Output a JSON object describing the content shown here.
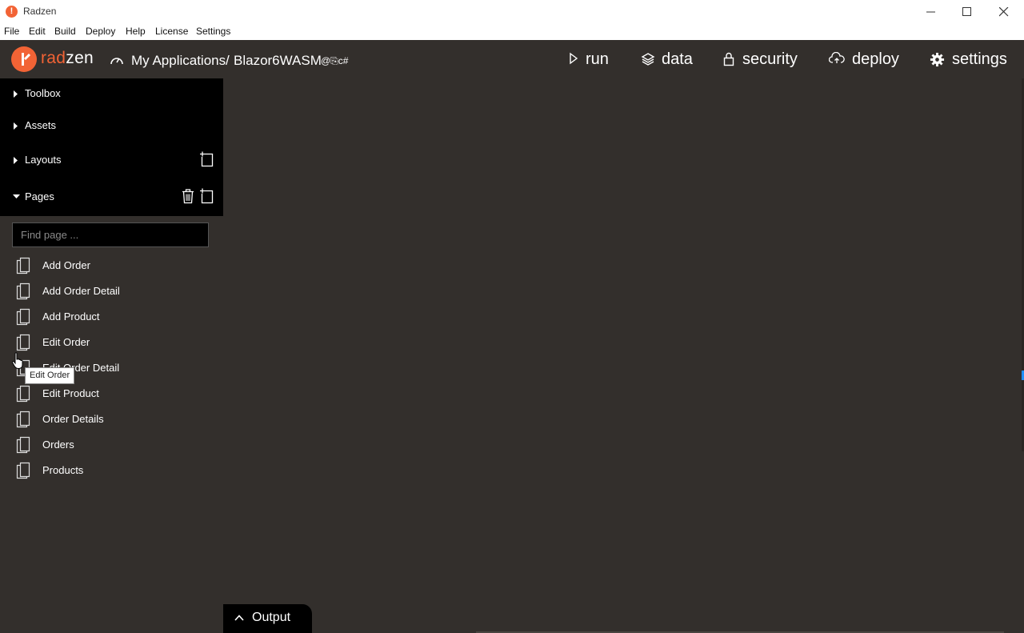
{
  "window": {
    "title": "Radzen",
    "logo_glyph": "!"
  },
  "menubar": {
    "items": [
      "File",
      "Edit",
      "Build",
      "Deploy",
      "Help",
      "License",
      "Settings"
    ]
  },
  "header": {
    "logo_rad": "rad",
    "logo_zen": "zen",
    "breadcrumb_root": "My Applications",
    "breadcrumb_sep": "/",
    "breadcrumb_app": "Blazor6WASM",
    "app_badges": "@⎘c#",
    "nav": {
      "run": "run",
      "data": "data",
      "security": "security",
      "deploy": "deploy",
      "settings": "settings"
    }
  },
  "sidebar": {
    "sections": [
      {
        "label": "Toolbox",
        "expanded": false
      },
      {
        "label": "Assets",
        "expanded": false
      },
      {
        "label": "Layouts",
        "expanded": false
      },
      {
        "label": "Pages",
        "expanded": true
      }
    ],
    "search_placeholder": "Find page ...",
    "pages": [
      "Add Order",
      "Add Order Detail",
      "Add Product",
      "Edit Order",
      "Edit Order Detail",
      "Edit Product",
      "Order Details",
      "Orders",
      "Products"
    ]
  },
  "tooltip": {
    "text": "Edit Order"
  },
  "output": {
    "label": "Output"
  },
  "colors": {
    "accent": "#f26335",
    "background": "#332f2c",
    "sidebar": "#000000"
  }
}
